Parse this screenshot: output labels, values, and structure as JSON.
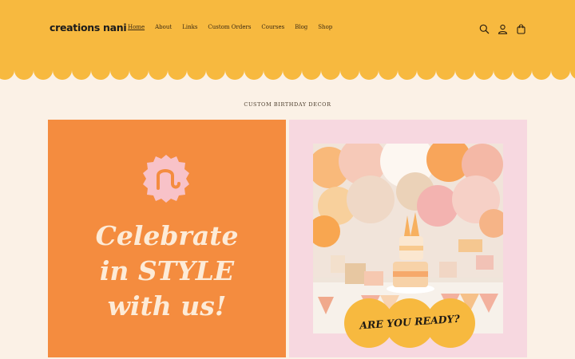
{
  "header": {
    "logo": "creations nani",
    "nav": [
      "Home",
      "About",
      "Links",
      "Custom Orders",
      "Courses",
      "Blog",
      "Shop"
    ],
    "icons": [
      "search-icon",
      "account-icon",
      "cart-icon"
    ]
  },
  "main": {
    "eyebrow": "CUSTOM BIRTHDAY DECOR",
    "headline_lines": [
      "Celebrate",
      "in STYLE",
      "with us!"
    ],
    "ready_label": "ARE YOU READY?"
  },
  "colors": {
    "header": "#f7b93f",
    "page_bg": "#fbf1e6",
    "left_panel": "#f48c3f",
    "right_panel": "#f7d8e0",
    "ready_badge": "#f7b93f"
  }
}
